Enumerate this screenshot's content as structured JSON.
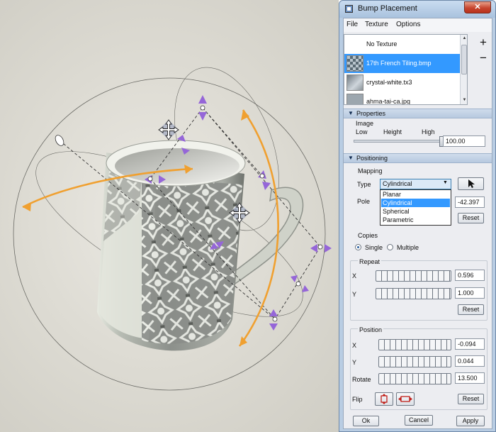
{
  "window": {
    "title": "Bump Placement",
    "close_glyph": "✕"
  },
  "menu": [
    "File",
    "Texture",
    "Options"
  ],
  "texture_list": {
    "items": [
      {
        "label": "No Texture",
        "selected": false
      },
      {
        "label": "17th French Tiling.bmp",
        "selected": true
      },
      {
        "label": "crystal-white.tx3",
        "selected": false
      },
      {
        "label": "ahma-tai-ca.jpg",
        "selected": false
      }
    ],
    "add_label": "+",
    "remove_label": "−"
  },
  "properties": {
    "header": "Properties",
    "image_label": "Image",
    "low_label": "Low",
    "height_label": "Height",
    "high_label": "High",
    "height_value": "100.00",
    "height_fraction": 1.0
  },
  "positioning": {
    "header": "Positioning",
    "mapping_label": "Mapping",
    "type_label": "Type",
    "type_value": "Cylindrical",
    "type_options": [
      "Planar",
      "Cylindrical",
      "Spherical",
      "Parametric"
    ],
    "pole_label": "Pole",
    "pole_value": "-42.397",
    "reset_label": "Reset"
  },
  "copies": {
    "label": "Copies",
    "single": "Single",
    "multiple": "Multiple",
    "selected": "Single"
  },
  "repeat": {
    "label": "Repeat",
    "x_label": "X",
    "x_value": "0.596",
    "y_label": "Y",
    "y_value": "1.000",
    "reset_label": "Reset"
  },
  "position": {
    "label": "Position",
    "x_label": "X",
    "x_value": "-0.094",
    "y_label": "Y",
    "y_value": "0.044",
    "rotate_label": "Rotate",
    "rotate_value": "13.500",
    "flip_label": "Flip",
    "reset_label": "Reset"
  },
  "buttons": {
    "ok": "Ok",
    "cancel": "Cancel",
    "apply": "Apply"
  },
  "colors": {
    "accent_select": "#3399ff",
    "gizmo_orange": "#f0a030",
    "gizmo_violet": "#9566d8"
  }
}
